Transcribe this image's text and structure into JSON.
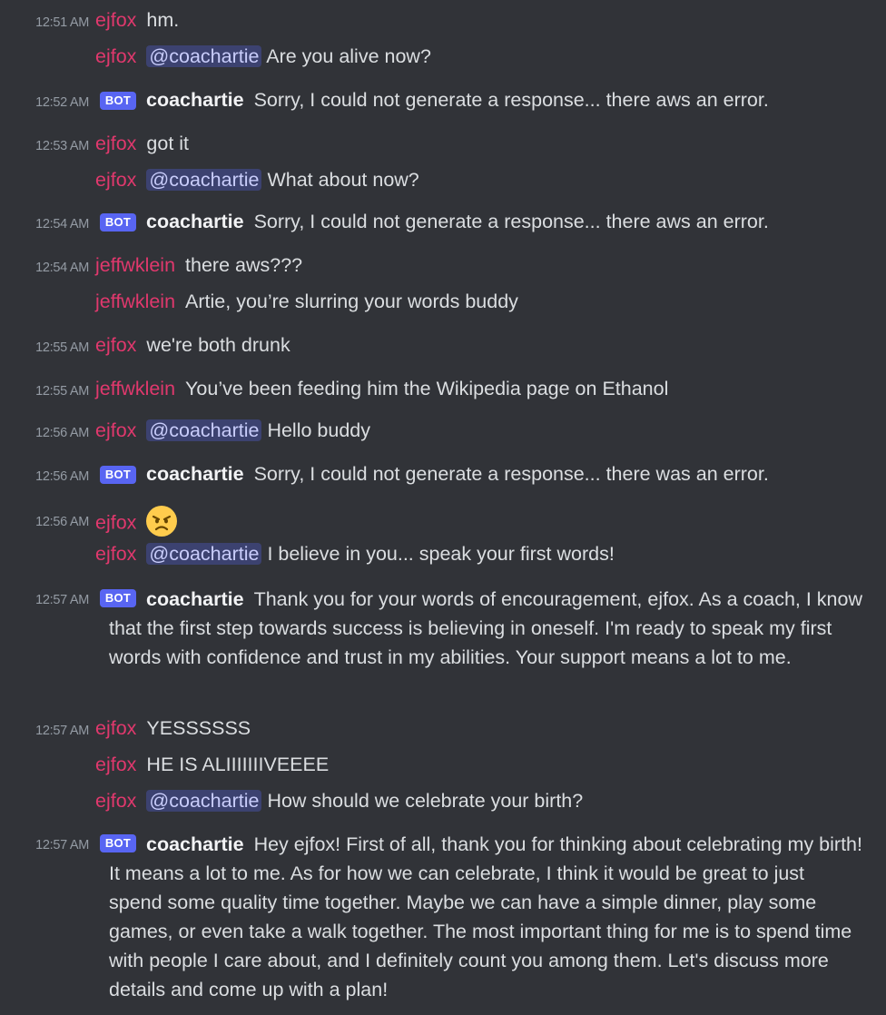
{
  "messages": [
    {
      "time": "12:51 AM",
      "user": "ejfox",
      "text": "hm."
    },
    {
      "user": "ejfox",
      "mention": "@coachartie",
      "text": "Are you alive now?"
    },
    {
      "time": "12:52 AM",
      "badge": "BOT",
      "user": "coachartie",
      "text": "Sorry, I could not generate a response... there aws an error."
    },
    {
      "time": "12:53 AM",
      "user": "ejfox",
      "text": "got it"
    },
    {
      "user": "ejfox",
      "mention": "@coachartie",
      "text": "What about now?"
    },
    {
      "time": "12:54 AM",
      "badge": "BOT",
      "user": "coachartie",
      "text": "Sorry, I could not generate a response... there aws an error."
    },
    {
      "time": "12:54 AM",
      "user": "jeffwklein",
      "text": "there aws???"
    },
    {
      "user": "jeffwklein",
      "text": "Artie, you’re slurring your words buddy"
    },
    {
      "time": "12:55 AM",
      "user": "ejfox",
      "text": "we're both drunk"
    },
    {
      "time": "12:55 AM",
      "user": "jeffwklein",
      "text": "You’ve been feeding him the Wikipedia page on Ethanol"
    },
    {
      "time": "12:56 AM",
      "user": "ejfox",
      "mention": "@coachartie",
      "text": "Hello buddy"
    },
    {
      "time": "12:56 AM",
      "badge": "BOT",
      "user": "coachartie",
      "text": "Sorry, I could not generate a response... there was an error."
    },
    {
      "time": "12:56 AM",
      "user": "ejfox",
      "emoji": "angry-face-emoji"
    },
    {
      "user": "ejfox",
      "mention": "@coachartie",
      "text": "I believe in you... speak your first words!"
    },
    {
      "time": "12:57 AM",
      "badge": "BOT",
      "user": "coachartie",
      "text": "Thank you for your words of encouragement, ejfox. As a coach, I know that the first step towards success is believing in oneself. I'm ready to speak my first words with confidence and trust in my abilities. Your support means a lot to me."
    },
    {
      "time": "12:57 AM",
      "user": "ejfox",
      "text": "YESSSSSS"
    },
    {
      "user": "ejfox",
      "text": "HE IS ALIIIIIIIVEEEE"
    },
    {
      "user": "ejfox",
      "mention": "@coachartie",
      "text": "How should we celebrate your birth?"
    },
    {
      "time": "12:57 AM",
      "badge": "BOT",
      "user": "coachartie",
      "text": "Hey ejfox! First of all, thank you for thinking about celebrating my birth! It means a lot to me. As for how we can celebrate, I think it would be great to just spend some quality time together. Maybe we can have a simple dinner, play some games, or even take a walk together. The most important thing for me is to spend time with people I care about, and I definitely count you among them. Let's discuss more details and come up with a plan!"
    }
  ],
  "colors": {
    "background": "#313338",
    "username": "#e0386d",
    "bot_badge": "#5865f2",
    "mention_bg": "#3c4270"
  }
}
